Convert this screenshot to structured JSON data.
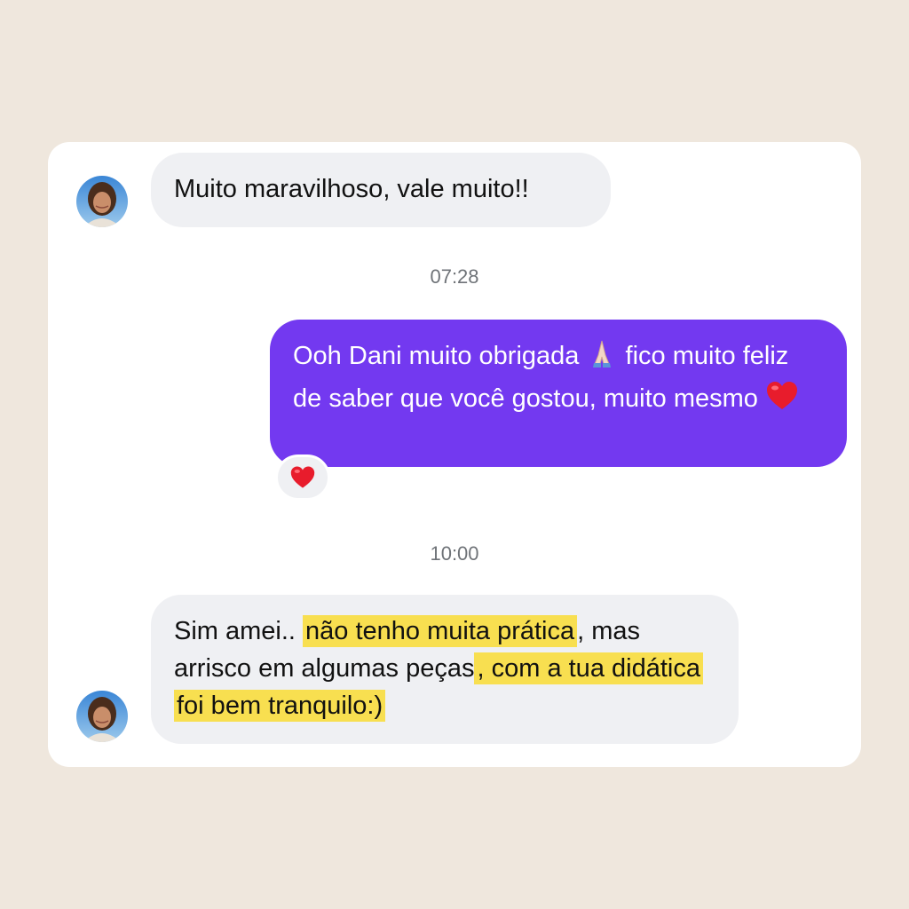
{
  "colors": {
    "page_background": "#efe7dd",
    "card_background": "#ffffff",
    "incoming_bubble": "#eff0f3",
    "outgoing_bubble": "#7339f0",
    "highlight": "#f8df50",
    "timestamp_text": "#6f7378"
  },
  "messages": [
    {
      "direction": "incoming",
      "avatar": "profile-photo-avatar",
      "text": "Muito maravilhoso, vale muito!!"
    },
    {
      "type": "timestamp",
      "text": "07:28"
    },
    {
      "direction": "outgoing",
      "segments": [
        "Ooh Dani muito obrigada",
        "fico muito feliz de saber que você gostou, muito mesmo"
      ],
      "emojis": [
        "folded-hands-emoji",
        "red-heart-emoji"
      ],
      "reaction": "red-heart-emoji"
    },
    {
      "type": "timestamp",
      "text": "10:00"
    },
    {
      "direction": "incoming",
      "avatar": "profile-photo-avatar",
      "segments": [
        {
          "text": "Sim amei.. ",
          "highlighted": false
        },
        {
          "text": "não tenho muita prática",
          "highlighted": true
        },
        {
          "text": ", mas arrisco em algumas peças",
          "highlighted": false
        },
        {
          "text": ", com a tua didática foi bem tranquilo:)",
          "highlighted": true
        }
      ]
    }
  ]
}
